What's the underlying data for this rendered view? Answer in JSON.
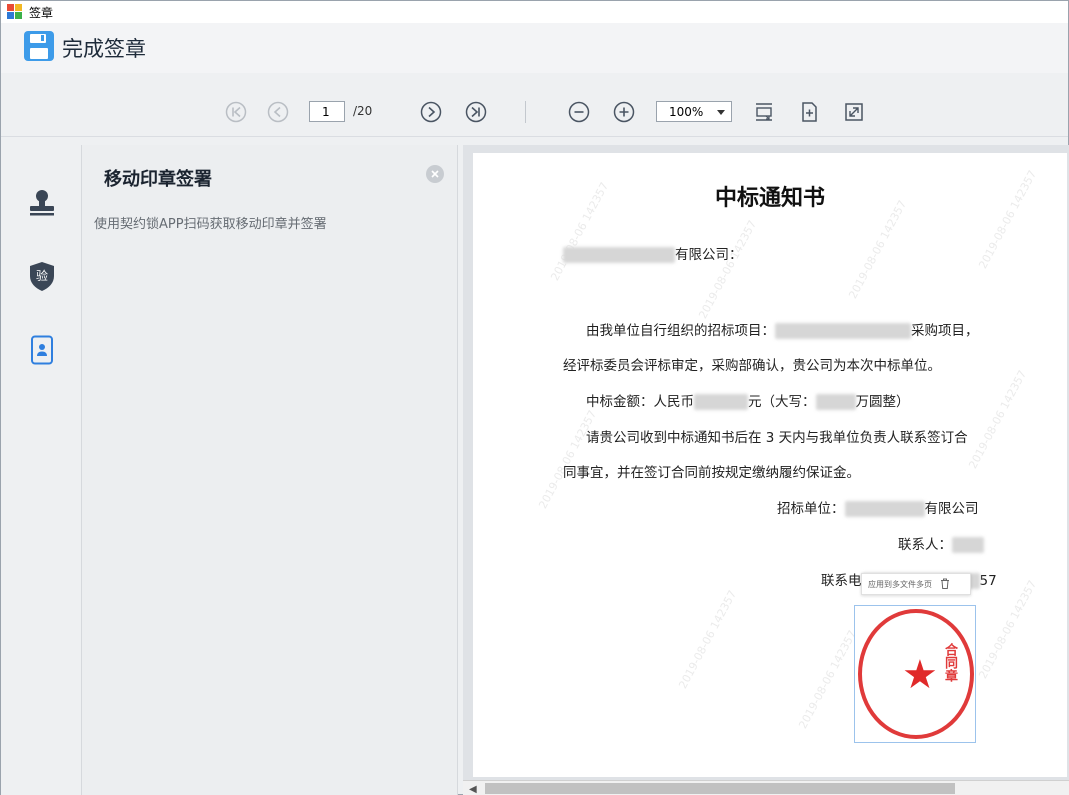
{
  "window": {
    "title": "签章"
  },
  "header": {
    "action_label": "完成签章"
  },
  "toolbar": {
    "page_current": "1",
    "page_total": "/20",
    "zoom": "100%"
  },
  "sidebar": {
    "items": [
      {
        "icon": "stamp-icon"
      },
      {
        "icon": "verify-shield-icon",
        "label": "验"
      },
      {
        "icon": "mobile-seal-icon"
      }
    ]
  },
  "panel": {
    "title": "移动印章签署",
    "description": "使用契约锁APP扫码获取移动印章并签署"
  },
  "document": {
    "title": "中标通知书",
    "salutation_suffix": "有限公司：",
    "p1_start": "由我单位自行组织的招标项目：",
    "p1_end": "采购项目，",
    "p2": "经评标委员会评标审定，采购部确认，贵公司为本次中标单位。",
    "p3_a": "中标金额：人民币",
    "p3_b": "元（大写：",
    "p3_c": "万圆整）",
    "p4": "请贵公司收到中标通知书后在 3 天内与我单位负责人联系签订合",
    "p5": "同事宜，并在签订合同前按规定缴纳履约保证金。",
    "issuer_label": "招标单位：",
    "issuer_suffix": "有限公司",
    "contact_label": "联系人：",
    "phone_label": "联系电",
    "phone_tail": "57",
    "seal_toolbar_label": "应用到多文件多页",
    "seal_text": "合同章",
    "watermark": "2019-08-06 142357"
  },
  "colors": {
    "accent": "#3d9be9",
    "seal_red": "#e03a3a",
    "text_dark": "#1b2430"
  }
}
